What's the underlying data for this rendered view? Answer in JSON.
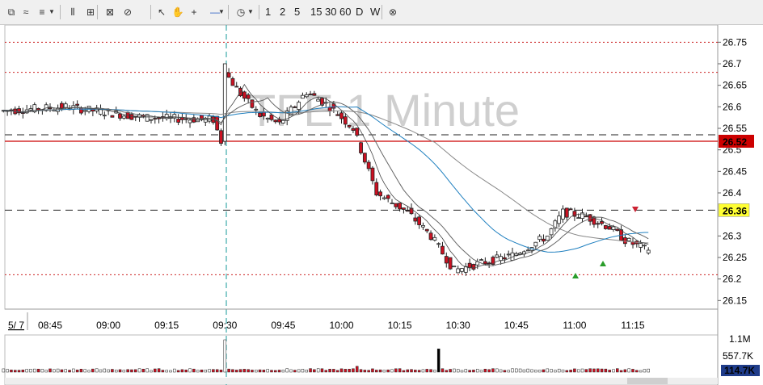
{
  "toolbar": {
    "icons": [
      "zoom-icon",
      "cursor-settings-icon",
      "chart-style-icon",
      "bar-spacing-icon",
      "auto-scale-icon",
      "fit-icon",
      "no-scale-icon",
      "pointer-icon",
      "pan-icon",
      "crosshair-icon",
      "line-tool-icon",
      "clock-icon"
    ],
    "periods": [
      "1",
      "2",
      "5",
      "15",
      "30",
      "60",
      "D",
      "W"
    ],
    "close_icon": "close-icon"
  },
  "chart": {
    "watermark": "TFE 1 Minute",
    "price_axis": {
      "labels": [
        "26.75",
        "26.7",
        "26.65",
        "26.6",
        "26.55",
        "26.5",
        "26.45",
        "26.4",
        "26.3",
        "26.25",
        "26.2",
        "26.15"
      ],
      "highlight_red": "26.52",
      "highlight_yellow": "26.36"
    },
    "time_axis": {
      "date_label": "5/ 7",
      "labels": [
        "08:45",
        "09:00",
        "09:15",
        "09:30",
        "09:45",
        "10:00",
        "10:15",
        "10:30",
        "10:45",
        "11:00",
        "11:15"
      ]
    },
    "volume_axis": {
      "labels": [
        "1.1M",
        "557.7K"
      ],
      "current": "114.7K"
    },
    "colors": {
      "up": "#ffffff",
      "down": "#cc1122",
      "ma_blue": "#1e7fbf",
      "ma_gray": "#777777",
      "red_line": "#cc0000",
      "yellow_tag": "#ffff33"
    }
  },
  "chart_data": {
    "type": "candlestick",
    "title": "TFE 1 Minute",
    "ylim": [
      26.13,
      26.79
    ],
    "x_ticks": [
      "08:45",
      "09:00",
      "09:15",
      "09:30",
      "09:45",
      "10:00",
      "10:15",
      "10:30",
      "10:45",
      "11:00",
      "11:15"
    ],
    "horizontal_levels": [
      {
        "value": 26.75,
        "style": "dotted-red"
      },
      {
        "value": 26.68,
        "style": "dotted-red"
      },
      {
        "value": 26.535,
        "style": "dashed-black"
      },
      {
        "value": 26.52,
        "style": "solid-red"
      },
      {
        "value": 26.36,
        "style": "dashed-black"
      },
      {
        "value": 26.21,
        "style": "dotted-red"
      }
    ],
    "last_price": 26.27,
    "volume_max": "1.1M",
    "volume_current": "114.7K"
  }
}
